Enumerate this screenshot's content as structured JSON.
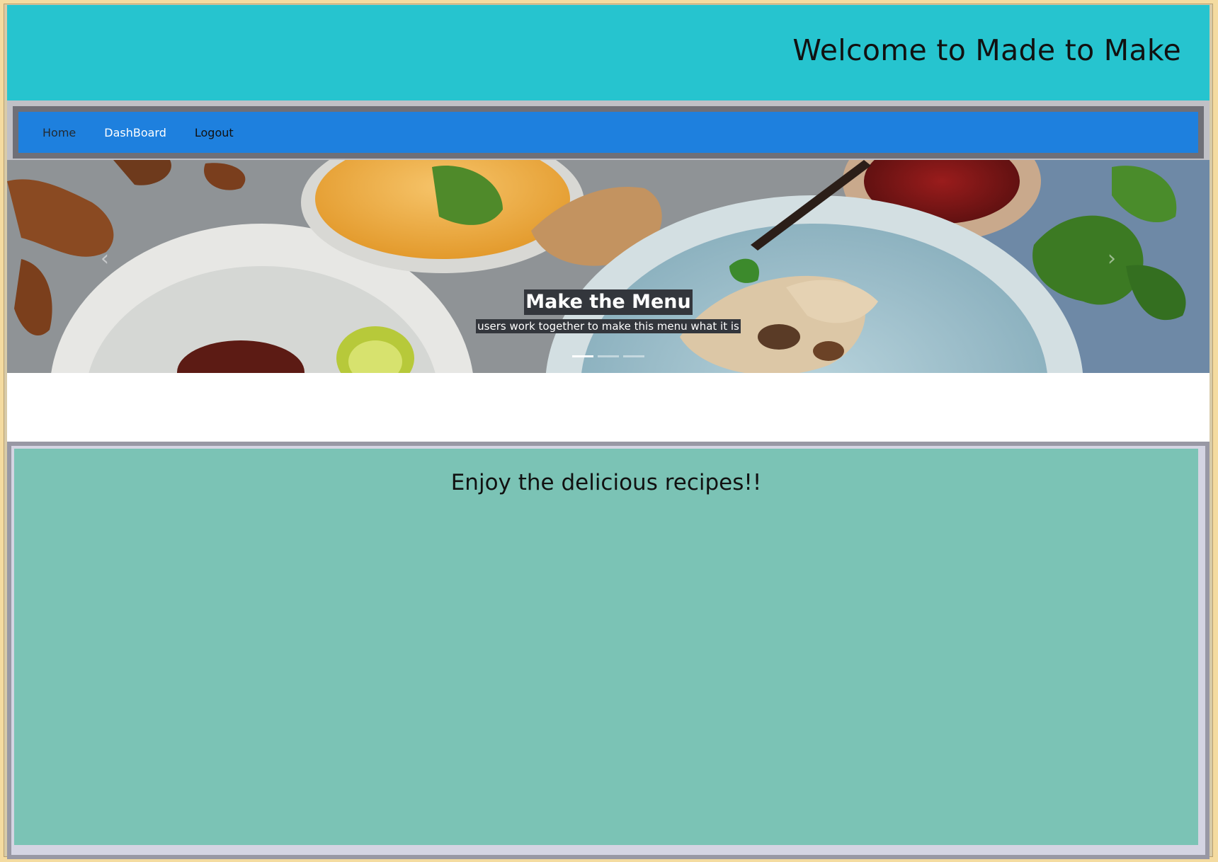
{
  "header": {
    "title": "Welcome to Made to Make"
  },
  "nav": {
    "items": [
      {
        "label": "Home"
      },
      {
        "label": "DashBoard"
      },
      {
        "label": "Logout"
      }
    ]
  },
  "carousel": {
    "caption_title": "Make the Menu",
    "caption_text": "users work together to make this menu what it is",
    "slide_count": 3,
    "active_slide": 1,
    "prev_icon": "chevron-left-icon",
    "next_icon": "chevron-right-icon"
  },
  "main": {
    "title": "Enjoy the delicious recipes!!"
  },
  "colors": {
    "header_bg": "#26c4cf",
    "nav_bg": "#1e80de",
    "content_bg": "#7bc3b5"
  }
}
